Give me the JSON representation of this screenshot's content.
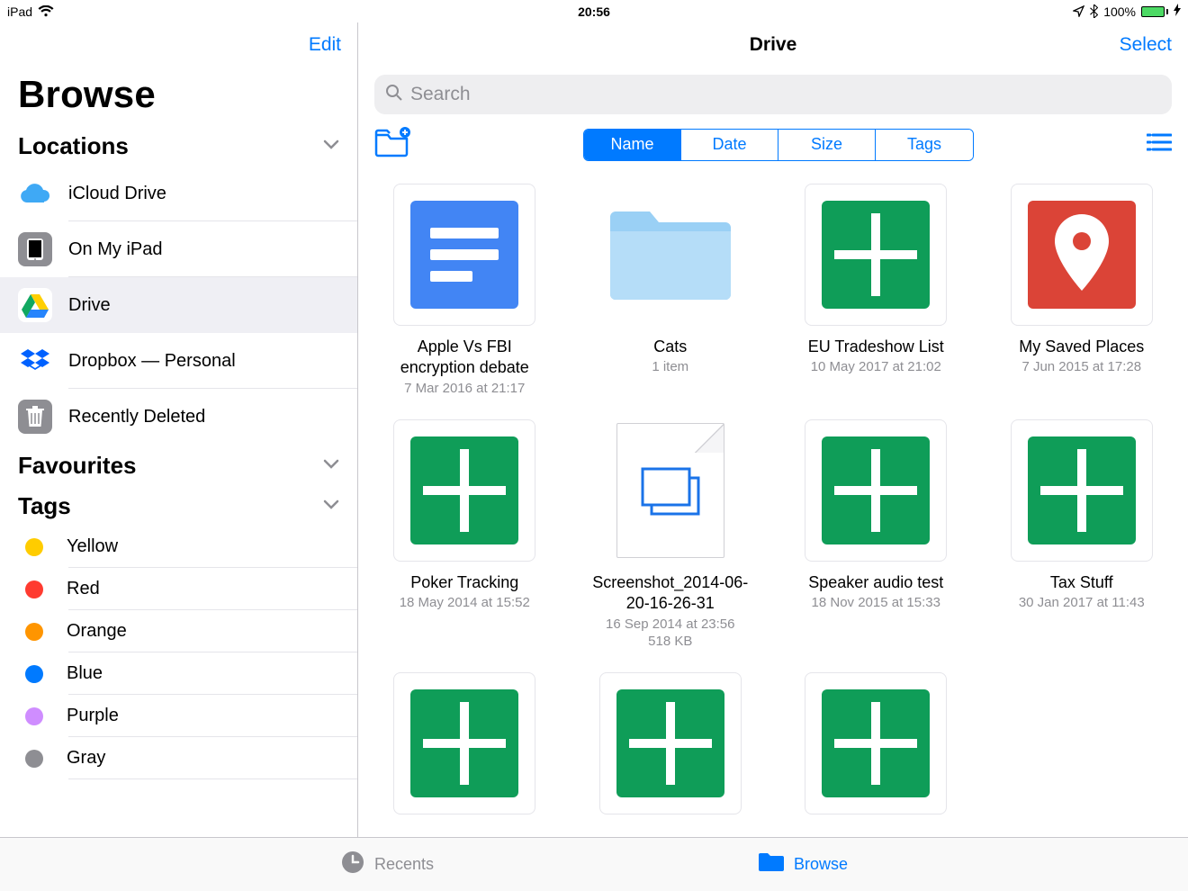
{
  "statusbar": {
    "device": "iPad",
    "time": "20:56",
    "battery": "100%"
  },
  "sidebar": {
    "edit": "Edit",
    "title": "Browse",
    "sections": {
      "locations": "Locations",
      "favourites": "Favourites",
      "tags": "Tags"
    },
    "locations": [
      {
        "label": "iCloud Drive"
      },
      {
        "label": "On My iPad"
      },
      {
        "label": "Drive"
      },
      {
        "label": "Dropbox — Personal"
      },
      {
        "label": "Recently Deleted"
      }
    ],
    "tags": [
      {
        "label": "Yellow",
        "color": "#ffcc00"
      },
      {
        "label": "Red",
        "color": "#ff3b30"
      },
      {
        "label": "Orange",
        "color": "#ff9500"
      },
      {
        "label": "Blue",
        "color": "#007aff"
      },
      {
        "label": "Purple",
        "color": "#cf8dff"
      },
      {
        "label": "Gray",
        "color": "#8e8e93"
      }
    ]
  },
  "main": {
    "title": "Drive",
    "select": "Select",
    "search_placeholder": "Search",
    "sort": {
      "options": [
        "Name",
        "Date",
        "Size",
        "Tags"
      ],
      "active": "Name"
    }
  },
  "files": [
    {
      "name": "Apple Vs FBI encryption debate",
      "meta": "7 Mar 2016 at 21:17",
      "type": "gdoc"
    },
    {
      "name": "Cats",
      "meta": "1 item",
      "type": "folder"
    },
    {
      "name": "EU Tradeshow List",
      "meta": "10 May 2017 at 21:02",
      "type": "gsheet"
    },
    {
      "name": "My Saved Places",
      "meta": "7 Jun 2015 at 17:28",
      "type": "gmap"
    },
    {
      "name": "Poker Tracking",
      "meta": "18 May 2014 at 15:52",
      "type": "gsheet"
    },
    {
      "name": "Screenshot_2014-06-20-16-26-31",
      "meta": "16 Sep 2014 at 23:56",
      "meta2": "518 KB",
      "type": "image"
    },
    {
      "name": "Speaker audio test",
      "meta": "18 Nov 2015 at 15:33",
      "type": "gsheet"
    },
    {
      "name": "Tax Stuff",
      "meta": "30 Jan 2017 at 11:43",
      "type": "gsheet"
    },
    {
      "name": "",
      "meta": "",
      "type": "gsheet"
    },
    {
      "name": "",
      "meta": "",
      "type": "gsheet"
    },
    {
      "name": "",
      "meta": "",
      "type": "gsheet"
    }
  ],
  "tabs": {
    "recents": "Recents",
    "browse": "Browse"
  }
}
